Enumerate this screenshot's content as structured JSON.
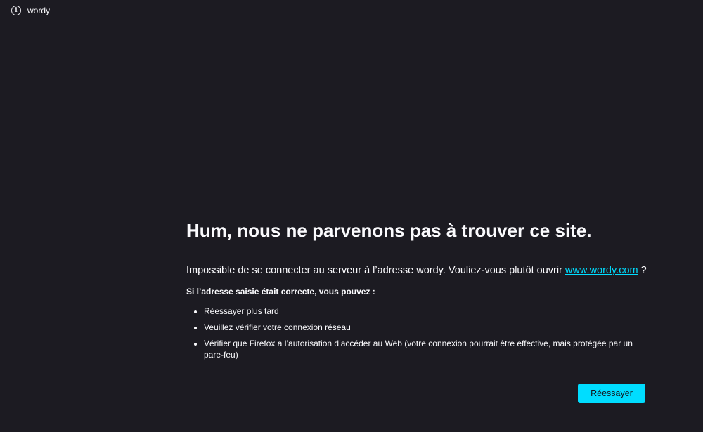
{
  "urlbar": {
    "icon": "info-icon",
    "url": "wordy"
  },
  "error": {
    "title": "Hum, nous ne parvenons pas à trouver ce site.",
    "description_prefix": "Impossible de se connecter au serveur à l’adresse wordy. Vouliez-vous plutôt ouvrir ",
    "suggested_link": "www.wordy.com",
    "description_suffix": " ?",
    "subheading": "Si l’adresse saisie était correcte, vous pouvez :",
    "suggestions": [
      "Réessayer plus tard",
      "Veuillez vérifier votre connexion réseau",
      "Vérifier que Firefox a l’autorisation d’accéder au Web (votre connexion pourrait être effective, mais protégée par un pare-feu)"
    ],
    "retry_label": "Réessayer"
  },
  "colors": {
    "background": "#1c1b22",
    "accent": "#00ddff",
    "text": "#fbfbfe"
  }
}
